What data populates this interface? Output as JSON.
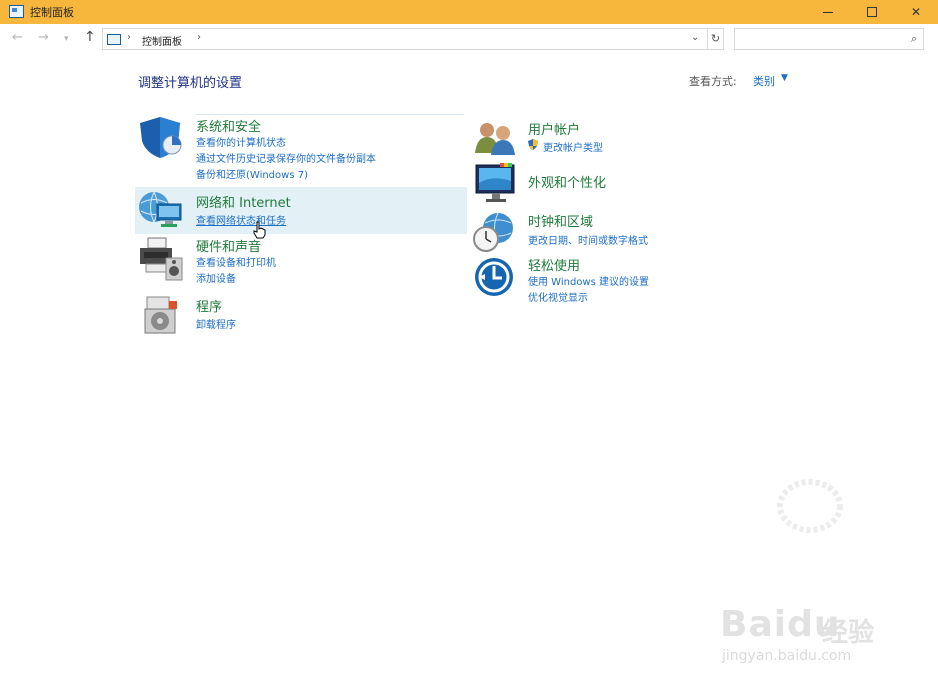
{
  "window": {
    "title": "控制面板"
  },
  "address_bar": {
    "breadcrumb": "控制面板",
    "search_placeholder": ""
  },
  "main": {
    "heading": "调整计算机的设置",
    "view_by_label": "查看方式:",
    "view_by_value": "类别"
  },
  "categories_left": [
    {
      "title": "系统和安全",
      "links": [
        "查看你的计算机状态",
        "通过文件历史记录保存你的文件备份副本",
        "备份和还原(Windows 7)"
      ]
    },
    {
      "title": "网络和 Internet",
      "links": [
        "查看网络状态和任务"
      ]
    },
    {
      "title": "硬件和声音",
      "links": [
        "查看设备和打印机",
        "添加设备"
      ]
    },
    {
      "title": "程序",
      "links": [
        "卸载程序"
      ]
    }
  ],
  "categories_right": [
    {
      "title": "用户帐户",
      "links": [
        "更改帐户类型"
      ]
    },
    {
      "title": "外观和个性化",
      "links": []
    },
    {
      "title": "时钟和区域",
      "links": [
        "更改日期、时间或数字格式"
      ]
    },
    {
      "title": "轻松使用",
      "links": [
        "使用 Windows 建议的设置",
        "优化视觉显示"
      ]
    }
  ],
  "watermark": {
    "logo": "Bai",
    "logo2": "du",
    "cn": "经验",
    "url": "jingyan.baidu.com"
  }
}
